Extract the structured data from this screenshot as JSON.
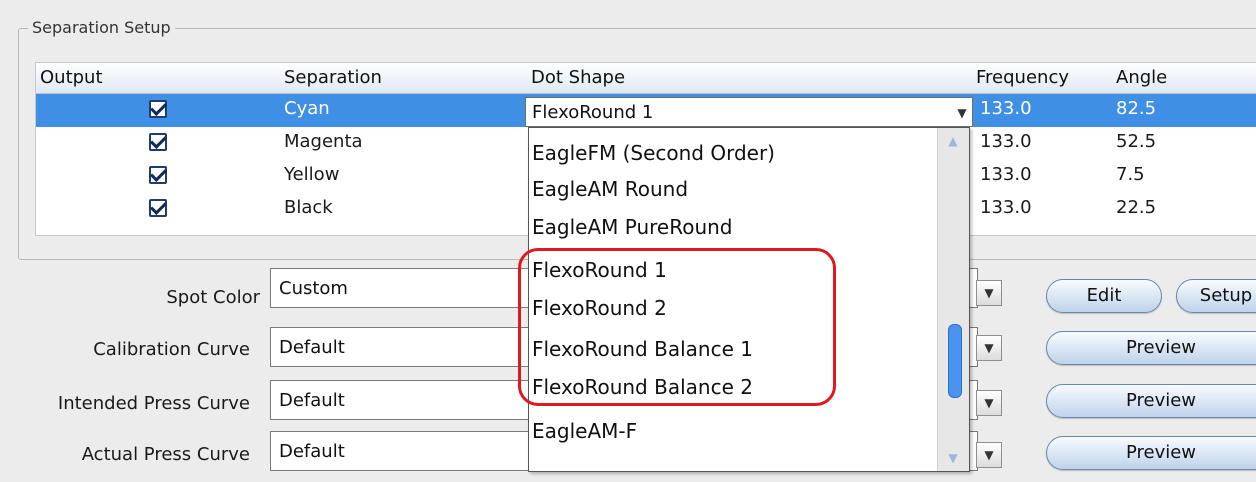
{
  "group_title": "Separation Setup",
  "table": {
    "headers": {
      "output": "Output",
      "separation": "Separation",
      "dot_shape": "Dot Shape",
      "frequency": "Frequency",
      "angle": "Angle"
    },
    "rows": [
      {
        "output": true,
        "separation": "Cyan",
        "frequency": "133.0",
        "angle": "82.5",
        "selected": true
      },
      {
        "output": true,
        "separation": "Magenta",
        "frequency": "133.0",
        "angle": "52.5"
      },
      {
        "output": true,
        "separation": "Yellow",
        "frequency": "133.0",
        "angle": "7.5"
      },
      {
        "output": true,
        "separation": "Black",
        "frequency": "133.0",
        "angle": "22.5"
      }
    ]
  },
  "dot_shape_combo": {
    "value": "FlexoRound 1"
  },
  "dropdown": {
    "options": [
      "EagleFM (Second Order)",
      "EagleAM Round",
      "EagleAM PureRound",
      "FlexoRound 1",
      "FlexoRound 2",
      "FlexoRound Balance 1",
      "FlexoRound Balance 2",
      "EagleAM-F"
    ]
  },
  "form": {
    "spot_color": {
      "label": "Spot Color",
      "value": "Custom"
    },
    "calibration_curve": {
      "label": "Calibration Curve",
      "value": "Default"
    },
    "intended_press_curve": {
      "label": "Intended Press Curve",
      "value": "Default"
    },
    "actual_press_curve": {
      "label": "Actual Press Curve",
      "value": "Default"
    }
  },
  "buttons": {
    "edit": "Edit",
    "setup": "Setup",
    "preview": "Preview"
  },
  "colors": {
    "selection": "#3f8fe4",
    "highlight": "#e0181f"
  }
}
